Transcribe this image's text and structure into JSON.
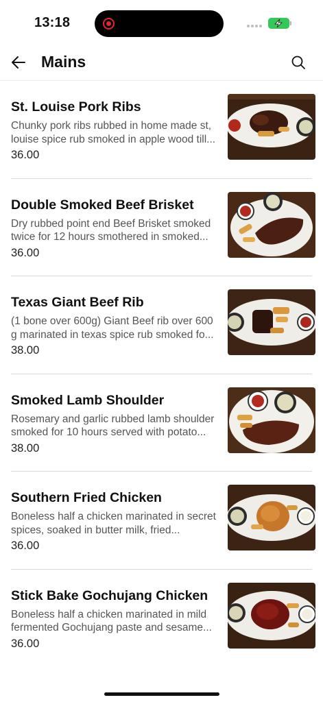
{
  "status_bar": {
    "time": "13:18",
    "battery_color": "#34c759",
    "recording_color": "#e2262f"
  },
  "header": {
    "title": "Mains",
    "back_icon": "arrow-left-icon",
    "search_icon": "search-icon"
  },
  "items": [
    {
      "name": "St. Louise Pork Ribs",
      "description": "Chunky pork ribs rubbed in home made st, louise spice rub smoked in apple wood till...",
      "price": "36.00"
    },
    {
      "name": "Double Smoked Beef Brisket",
      "description": "Dry rubbed point end Beef Brisket smoked twice for 12 hours smothered in smoked...",
      "price": "36.00"
    },
    {
      "name": "Texas Giant Beef Rib",
      "description": "(1 bone over 600g) Giant Beef rib over 600 g marinated in texas spice rub smoked fo...",
      "price": "38.00"
    },
    {
      "name": "Smoked Lamb Shoulder",
      "description": "Rosemary and garlic rubbed lamb shoulder smoked for 10 hours served with potato...",
      "price": "38.00"
    },
    {
      "name": "Southern Fried Chicken",
      "description": "Boneless half a chicken marinated in secret spices, soaked in butter milk, fried...",
      "price": "36.00"
    },
    {
      "name": "Stick Bake Gochujang Chicken",
      "description": "Boneless half a chicken marinated in mild fermented Gochujang paste and sesame...",
      "price": "36.00"
    }
  ]
}
